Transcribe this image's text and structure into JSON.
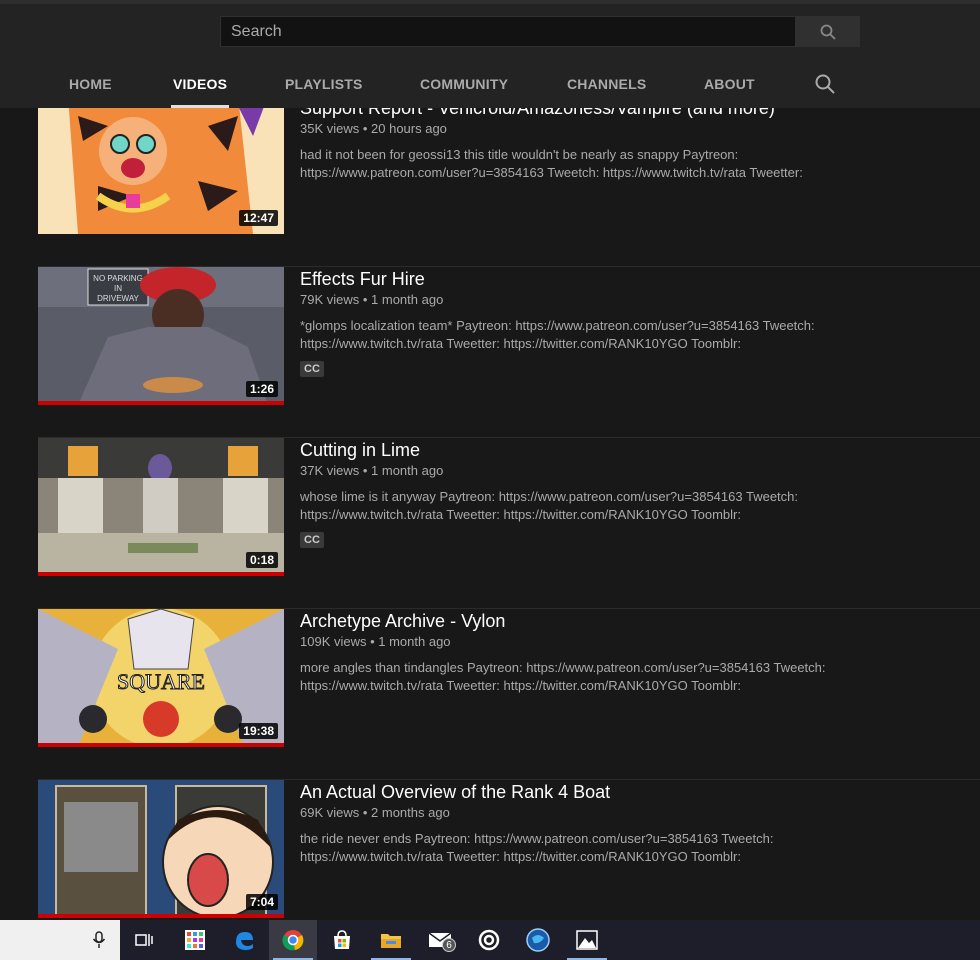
{
  "search": {
    "placeholder": "Search"
  },
  "tabs": [
    {
      "label": "HOME"
    },
    {
      "label": "VIDEOS"
    },
    {
      "label": "PLAYLISTS"
    },
    {
      "label": "COMMUNITY"
    },
    {
      "label": "CHANNELS"
    },
    {
      "label": "ABOUT"
    }
  ],
  "videos": [
    {
      "title": "Support Report - Venicroid/Amazoness/Vampire (and more)",
      "meta": "35K views • 20 hours ago",
      "desc": "had it not been for geossi13 this title wouldn't be nearly as snappy Paytreon: https://www.patreon.com/user?u=3854163 Tweetch: https://www.twitch.tv/rata Tweetter:",
      "duration": "12:47"
    },
    {
      "title": "Effects Fur Hire",
      "meta": "79K views • 1 month ago",
      "desc": "*glomps localization team* Paytreon: https://www.patreon.com/user?u=3854163 Tweetch: https://www.twitch.tv/rata Tweetter: https://twitter.com/RANK10YGO Toomblr:",
      "duration": "1:26",
      "cc": "CC"
    },
    {
      "title": "Cutting in Lime",
      "meta": "37K views • 1 month ago",
      "desc": "whose lime is it anyway Paytreon: https://www.patreon.com/user?u=3854163 Tweetch: https://www.twitch.tv/rata Tweetter: https://twitter.com/RANK10YGO Toomblr:",
      "duration": "0:18",
      "cc": "CC"
    },
    {
      "title": "Archetype Archive - Vylon",
      "meta": "109K views • 1 month ago",
      "desc": "more angles than tindangles Paytreon: https://www.patreon.com/user?u=3854163 Tweetch: https://www.twitch.tv/rata Tweetter: https://twitter.com/RANK10YGO Toomblr:",
      "duration": "19:38",
      "thumb_text": "SQUARE"
    },
    {
      "title": "An Actual Overview of the Rank 4 Boat",
      "meta": "69K views • 2 months ago",
      "desc": "the ride never ends Paytreon: https://www.patreon.com/user?u=3854163 Tweetch: https://www.twitch.tv/rata Tweetter: https://twitter.com/RANK10YGO Toomblr:",
      "duration": "7:04"
    }
  ],
  "thumb_signs": {
    "parking": "NO PARKING IN DRIVEWAY"
  },
  "taskbar": {
    "mail_badge": "6",
    "icons": [
      "microphone-icon",
      "task-view-icon",
      "app-grid-icon",
      "edge-icon",
      "chrome-icon",
      "store-icon",
      "file-explorer-icon",
      "mail-icon",
      "target-app-icon",
      "globe-app-icon",
      "photos-icon"
    ]
  },
  "colors": {
    "accent": "#cc0000",
    "background": "#181818",
    "header": "#232323"
  }
}
